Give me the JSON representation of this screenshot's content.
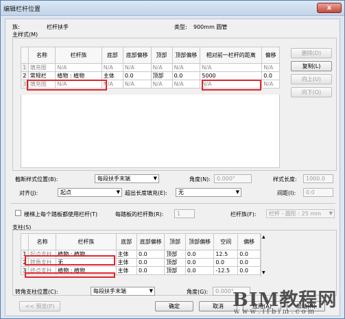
{
  "window": {
    "title": "编辑栏杆位置",
    "close_glyph": "x"
  },
  "header": {
    "family_label": "族:",
    "family_value": "栏杆扶手",
    "type_label": "类型:",
    "type_value": "900mm 圆管"
  },
  "main_pattern": {
    "group_label": "主样式(M)",
    "columns": [
      "",
      "名称",
      "栏杆族",
      "底部",
      "底部偏移",
      "顶部",
      "顶部偏移",
      "相对前一栏杆的距离",
      "偏移"
    ],
    "rows": [
      {
        "idx": "1",
        "name": "填充图",
        "family": "N/A",
        "base": "N/A",
        "base_offset": "N/A",
        "top": "N/A",
        "top_offset": "N/A",
        "distance": "N/A",
        "offset": "N/A",
        "dim": true
      },
      {
        "idx": "2",
        "name": "常规栏",
        "family": "植物 : 植物",
        "base": "主体",
        "base_offset": "0.0",
        "top": "顶部",
        "top_offset": "0.0",
        "distance": "5000",
        "offset": "0.0",
        "dim": false
      },
      {
        "idx": "3",
        "name": "填充图",
        "family": "N/A",
        "base": "N/A",
        "base_offset": "N/A",
        "top": "N/A",
        "top_offset": "N/A",
        "distance": "N/A",
        "offset": "N/A",
        "dim": true
      }
    ],
    "buttons": {
      "delete": "删除(D)",
      "copy": "复制(L)",
      "up": "向上(U)",
      "down": "向下(O)"
    }
  },
  "break_options": {
    "break_pos_label": "截断样式位置(B):",
    "break_pos_value": "每段扶手末端",
    "angle_label": "角度(N):",
    "angle_value": "0.000°",
    "pattern_length_label": "样式长度:",
    "pattern_length_value": "1000.0",
    "justify_label": "对齐(J):",
    "justify_value": "起点",
    "excess_label": "超出长度填充(E):",
    "excess_value": "无",
    "spacing_label": "间距(I):",
    "spacing_value": "0.0"
  },
  "tread_options": {
    "checkbox_label": "楼梯上每个踏板都使用栏杆(T)",
    "per_tread_label": "每踏板的栏杆数(R):",
    "per_tread_value": "1",
    "baluster_family_label": "栏杆族(F):",
    "baluster_family_value": "栏杆 - 圆形 : 25 mm"
  },
  "posts": {
    "group_label": "支柱(S)",
    "columns": [
      "",
      "名称",
      "栏杆族",
      "底部",
      "底部偏移",
      "顶部",
      "顶部偏移",
      "空间",
      "偏移"
    ],
    "rows": [
      {
        "idx": "1",
        "name": "起点支柱",
        "family": "植物 : 植物",
        "base": "主体",
        "base_offset": "0.0",
        "top": "顶部",
        "top_offset": "0.0",
        "space": "12.5",
        "offset": "0.0"
      },
      {
        "idx": "2",
        "name": "转角支柱",
        "family": "无",
        "base": "主体",
        "base_offset": "0.0",
        "top": "顶部",
        "top_offset": "0.0",
        "space": "0.0",
        "offset": "0.0"
      },
      {
        "idx": "3",
        "name": "终点支柱",
        "family": "植物 : 植物",
        "base": "主体",
        "base_offset": "0.0",
        "top": "顶部",
        "top_offset": "0.0",
        "space": "-12.5",
        "offset": "0.0"
      }
    ],
    "corner_pos_label": "转角支柱位置(C):",
    "corner_pos_value": "每段扶手末端",
    "angle_label": "角度(G):",
    "angle_value": "0.000°"
  },
  "footer": {
    "preview": "<< 预览(P)",
    "ok": "确定",
    "cancel": "取消",
    "apply": "应用(A)",
    "help": "帮助(H)"
  },
  "watermark": {
    "title": "BIM教程网",
    "url": "w w w . i f b i m . c o m"
  }
}
